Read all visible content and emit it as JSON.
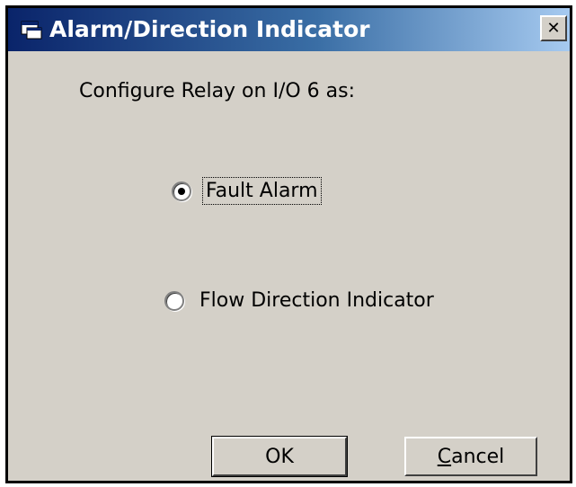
{
  "window": {
    "title": "Alarm/Direction Indicator",
    "icon": "dialog-app-icon",
    "close_label": "✕"
  },
  "prompt": "Configure Relay on I/O 6 as:",
  "options": [
    {
      "label": "Fault Alarm",
      "selected": true,
      "focused": true
    },
    {
      "label": "Flow Direction Indicator",
      "selected": false,
      "focused": false
    }
  ],
  "buttons": {
    "ok_label": "OK",
    "cancel_accesskey": "C",
    "cancel_rest": "ancel"
  },
  "colors": {
    "face": "#d4d0c8",
    "title_start": "#0a246a",
    "title_end": "#a6caf0"
  }
}
